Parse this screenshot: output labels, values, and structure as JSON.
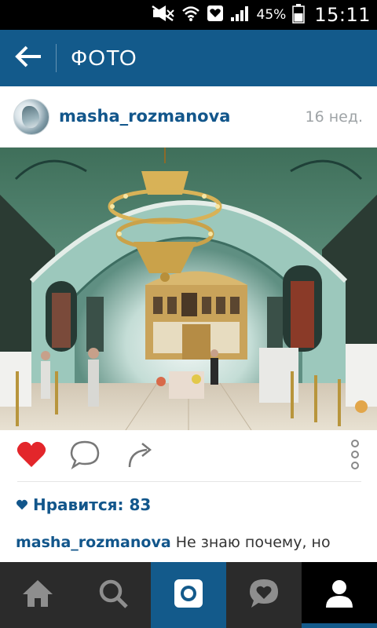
{
  "status_bar": {
    "battery_percent": "45%",
    "time": "15:11"
  },
  "header": {
    "title": "ФОТО"
  },
  "post": {
    "username": "masha_rozmanova",
    "time_ago": "16 нед.",
    "likes_label": "Нравится: 83",
    "caption_user": "masha_rozmanova",
    "caption_text": "Не знаю почему, но"
  },
  "icons": {
    "back": "arrow-left-icon",
    "like": "heart-icon",
    "comment": "speech-bubble-icon",
    "share": "share-arrow-icon",
    "more": "vertical-dots-icon",
    "home": "home-icon",
    "explore": "search-icon",
    "camera": "camera-icon",
    "activity": "heart-bubble-icon",
    "profile": "person-icon"
  },
  "colors": {
    "brand": "#135a8b",
    "like_red": "#e3262b",
    "username": "#12568b",
    "nav_bg": "#2b2b2b"
  }
}
